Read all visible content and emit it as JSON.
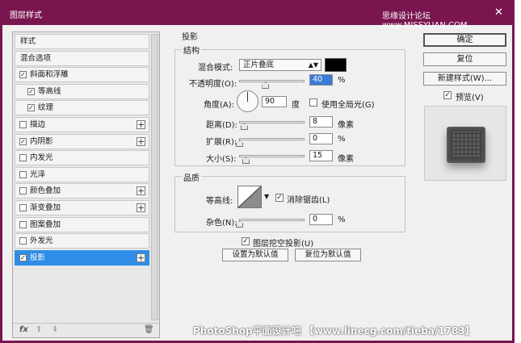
{
  "window": {
    "title": "图层样式",
    "site_label": "思缘设计论坛 www.MISSYUAN.COM",
    "close_glyph": "✕"
  },
  "left_panel": {
    "items": [
      {
        "label": "样式",
        "checkbox": false,
        "checked": false,
        "plus": false,
        "indent": false,
        "selected": false
      },
      {
        "label": "混合选项",
        "checkbox": false,
        "checked": false,
        "plus": false,
        "indent": false,
        "selected": false
      },
      {
        "label": "斜面和浮雕",
        "checkbox": true,
        "checked": true,
        "plus": false,
        "indent": false,
        "selected": false
      },
      {
        "label": "等高线",
        "checkbox": true,
        "checked": true,
        "plus": false,
        "indent": true,
        "selected": false
      },
      {
        "label": "纹理",
        "checkbox": true,
        "checked": true,
        "plus": false,
        "indent": true,
        "selected": false
      },
      {
        "label": "描边",
        "checkbox": true,
        "checked": false,
        "plus": true,
        "indent": false,
        "selected": false
      },
      {
        "label": "内阴影",
        "checkbox": true,
        "checked": true,
        "plus": true,
        "indent": false,
        "selected": false
      },
      {
        "label": "内发光",
        "checkbox": true,
        "checked": false,
        "plus": false,
        "indent": false,
        "selected": false
      },
      {
        "label": "光泽",
        "checkbox": true,
        "checked": false,
        "plus": false,
        "indent": false,
        "selected": false
      },
      {
        "label": "颜色叠加",
        "checkbox": true,
        "checked": false,
        "plus": true,
        "indent": false,
        "selected": false
      },
      {
        "label": "渐变叠加",
        "checkbox": true,
        "checked": false,
        "plus": true,
        "indent": false,
        "selected": false
      },
      {
        "label": "图案叠加",
        "checkbox": true,
        "checked": false,
        "plus": false,
        "indent": false,
        "selected": false
      },
      {
        "label": "外发光",
        "checkbox": true,
        "checked": false,
        "plus": false,
        "indent": false,
        "selected": false
      },
      {
        "label": "投影",
        "checkbox": true,
        "checked": true,
        "plus": true,
        "indent": false,
        "selected": true
      }
    ],
    "bottom_icons": [
      "fx-icon",
      "up-arrow-icon",
      "down-arrow-icon",
      "trash-icon"
    ],
    "fx_label": "fx",
    "up_glyph": "⬆",
    "down_glyph": "⬇",
    "trash_glyph": "🗑"
  },
  "drop_shadow": {
    "section_title": "投影",
    "structure_title": "结构",
    "blend_mode_label": "混合模式:",
    "blend_mode_value": "正片叠底",
    "shadow_color": "#000000",
    "opacity_label": "不透明度(O):",
    "opacity_value": "40",
    "opacity_unit": "%",
    "opacity_fraction": 0.4,
    "angle_label": "角度(A):",
    "angle_value": "90",
    "angle_unit": "度",
    "global_light_label": "使用全局光(G)",
    "global_light_checked": false,
    "distance_label": "距离(D):",
    "distance_value": "8",
    "distance_unit": "像素",
    "spread_label": "扩展(R):",
    "spread_value": "0",
    "spread_unit": "%",
    "size_label": "大小(S):",
    "size_value": "15",
    "size_unit": "像素",
    "quality_title": "品质",
    "contour_label": "等高线:",
    "anti_alias_label": "消除锯齿(L)",
    "anti_alias_checked": true,
    "noise_label": "杂色(N):",
    "noise_value": "0",
    "noise_unit": "%",
    "knockout_label": "图层挖空投影(U)",
    "knockout_checked": true,
    "make_default_label": "设置为默认值",
    "reset_default_label": "复位为默认值"
  },
  "right_panel": {
    "ok_label": "确定",
    "reset_label": "复位",
    "new_style_label": "新建样式(W)...",
    "preview_label": "预览(V)",
    "preview_checked": true
  },
  "watermark": "PhotoShop平面设计吧 【www.linecg.com/tieba/1783】"
}
